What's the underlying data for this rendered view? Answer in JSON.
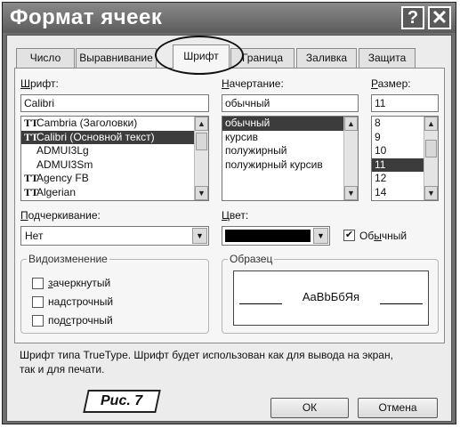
{
  "window": {
    "title": "Формат ячеек",
    "help_glyph": "?",
    "close_glyph": "✕"
  },
  "tabs": [
    {
      "label": "Число"
    },
    {
      "label": "Выравнивание"
    },
    {
      "label": "Шрифт"
    },
    {
      "label": "Граница"
    },
    {
      "label": "Заливка"
    },
    {
      "label": "Защита"
    }
  ],
  "font": {
    "label_first": "Ш",
    "label_rest": "рифт:",
    "value": "Calibri",
    "items": [
      {
        "icon": "TT",
        "name": "Cambria (Заголовки)"
      },
      {
        "icon": "TT",
        "name": "Calibri (Основной текст)"
      },
      {
        "icon": "",
        "name": "ADMUI3Lg"
      },
      {
        "icon": "",
        "name": "ADMUI3Sm"
      },
      {
        "icon": "TT",
        "name": "Agency FB"
      },
      {
        "icon": "TT",
        "name": "Algerian"
      }
    ]
  },
  "style": {
    "label_first": "Н",
    "label_rest": "ачертание:",
    "value": "обычный",
    "items": [
      "обычный",
      "курсив",
      "полужирный",
      "полужирный курсив"
    ]
  },
  "size": {
    "label_first": "Р",
    "label_rest": "азмер:",
    "value": "11",
    "items": [
      "8",
      "9",
      "10",
      "11",
      "12",
      "14"
    ]
  },
  "underline": {
    "label_first": "П",
    "label_rest": "одчеркивание:",
    "value": "Нет"
  },
  "color": {
    "label_first": "Ц",
    "label_rest": "вет:",
    "swatch": "#000000",
    "normal_label_pre": "Об",
    "normal_label_u": "ы",
    "normal_label_post": "чный",
    "normal_checked": true
  },
  "effects": {
    "title": "Видоизменение",
    "items": [
      {
        "pre": "",
        "u": "з",
        "post": "ачеркнутый"
      },
      {
        "pre": "на",
        "u": "д",
        "post": "строчный"
      },
      {
        "pre": "под",
        "u": "с",
        "post": "трочный"
      }
    ]
  },
  "preview": {
    "title": "Образец",
    "sample": "AaBbБбЯя"
  },
  "description": {
    "line1": "Шрифт типа TrueType. Шрифт будет использован как для вывода на экран,",
    "line2": "так и для печати."
  },
  "buttons": {
    "ok": "ОК",
    "cancel": "Отмена"
  },
  "caption": "Рис. 7"
}
